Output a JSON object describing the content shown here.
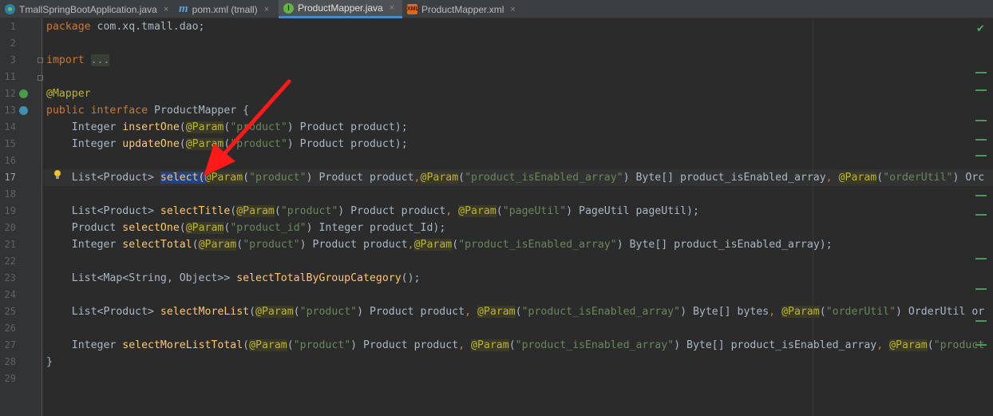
{
  "tabs": [
    {
      "label": "TmallSpringBootApplication.java",
      "icon": "spring-boot-icon",
      "active": false
    },
    {
      "label": "pom.xml (tmall)",
      "icon": "maven-icon",
      "active": false
    },
    {
      "label": "ProductMapper.java",
      "icon": "java-interface-icon",
      "active": true
    },
    {
      "label": "ProductMapper.xml",
      "icon": "xml-file-icon",
      "active": false
    }
  ],
  "tab_close_glyph": "×",
  "editor": {
    "line_numbers": [
      "1",
      "2",
      "3",
      "11",
      "12",
      "13",
      "14",
      "15",
      "16",
      "17",
      "18",
      "19",
      "20",
      "21",
      "22",
      "23",
      "24",
      "25",
      "26",
      "27",
      "28",
      "29"
    ],
    "current_line": "17",
    "inspection_status_icon": "check-icon",
    "lines": {
      "l1": {
        "kw": "package",
        "rest": " com.xq.tmall.dao;"
      },
      "l3": {
        "kw": "import",
        "folded": "..."
      },
      "l12": {
        "ann": "@Mapper"
      },
      "l13": {
        "kw1": "public",
        "kw2": "interface",
        "rest": " ProductMapper {"
      },
      "l14": {
        "type": "Integer ",
        "fn": "insertOne",
        "p1": "(",
        "ann": "@Param",
        "p2": "(",
        "str": "\"product\"",
        "rest": ") Product product);"
      },
      "l15": {
        "type": "Integer ",
        "fn": "updateOne",
        "p1": "(",
        "ann": "@Param",
        "p2": "(",
        "str": "\"product\"",
        "rest": ") Product product);"
      },
      "l17": {
        "type": "List<Product> ",
        "sel": "select(",
        "ann1": "@Param",
        "s1": "\"product\"",
        "t1": ") Product product",
        "c1": ",",
        "ann2": "@Param",
        "s2": "\"product_isEnabled_array\"",
        "t2": ") Byte[] product_isEnabled_array",
        "c2": ", ",
        "ann3": "@Param",
        "s3": "\"orderUtil\"",
        "t3": ") Orc"
      },
      "l19": {
        "type": "List<Product> ",
        "fn": "selectTitle",
        "ann1": "@Param",
        "s1": "\"product\"",
        "t1": ") Product product",
        "ann2": "@Param",
        "s2": "\"pageUtil\"",
        "t2": ") PageUtil pageUtil);"
      },
      "l20": {
        "type": "Product ",
        "fn": "selectOne",
        "ann1": "@Param",
        "s1": "\"product_id\"",
        "t1": ") Integer product_Id);"
      },
      "l21": {
        "type": "Integer ",
        "fn": "selectTotal",
        "ann1": "@Param",
        "s1": "\"product\"",
        "t1": ") Product product",
        "ann2": "@Param",
        "s2": "\"product_isEnabled_array\"",
        "t2": ") Byte[] product_isEnabled_array);"
      },
      "l23": {
        "type": "List<Map<String, Object>> ",
        "fn": "selectTotalByGroupCategory",
        "rest": "();"
      },
      "l25": {
        "type": "List<Product> ",
        "fn": "selectMoreList",
        "ann1": "@Param",
        "s1": "\"product\"",
        "t1": ") Product product",
        "ann2": "@Param",
        "s2": "\"product_isEnabled_array\"",
        "t2": ") Byte[] bytes",
        "ann3": "@Param",
        "s3": "\"orderUtil\"",
        "t3": ") OrderUtil or"
      },
      "l27": {
        "type": "Integer ",
        "fn": "selectMoreListTotal",
        "ann1": "@Param",
        "s1": "\"product\"",
        "t1": ") Product product",
        "ann2": "@Param",
        "s2": "\"product_isEnabled_array\"",
        "t2": ") Byte[] product_isEnabled_array",
        "ann3": "@Param",
        "s3": "\"product"
      },
      "l28": {
        "rest": "}"
      }
    }
  },
  "colors": {
    "keyword": "#cc7832",
    "annotation": "#bbb529",
    "method": "#ffc66d",
    "string": "#6a8759",
    "text": "#a9b7c6",
    "selection": "#214283",
    "arrow": "#ff1a1a"
  }
}
